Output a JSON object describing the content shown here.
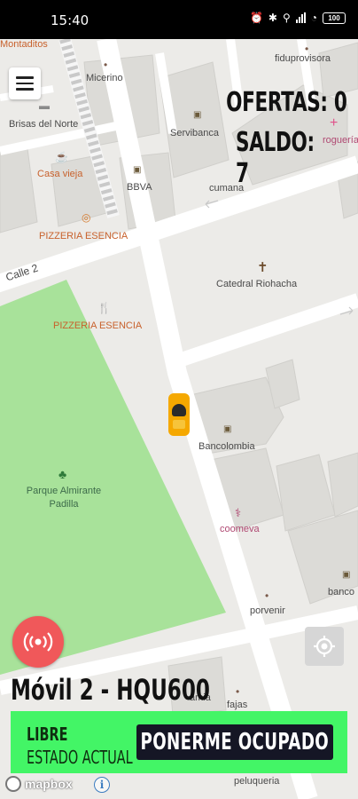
{
  "status_bar": {
    "time": "15:40",
    "battery": "100",
    "icons": [
      "alarm-icon",
      "bluetooth-icon",
      "location-icon",
      "signal-icon",
      "wifi-icon",
      "battery-icon"
    ]
  },
  "map": {
    "pois": {
      "montaditos": "Montaditos",
      "fiduprovisora": "fiduprovisora",
      "micerino": "Micerino",
      "brisas": "Brisas del Norte",
      "servibanca": "Servibanca",
      "drogueria": "roguería la eco",
      "casa_vieja": "Casa vieja",
      "bbva": "BBVA",
      "cumana": "cumana",
      "pizzeria_1": "PIZZERIA ESENCIA",
      "calle": "Calle 2",
      "catedral": "Catedral Riohacha",
      "pizzeria_2": "PIZZERIA ESENCIA",
      "bancolombia": "Bancolombia",
      "parque": "Parque Almirante Padilla",
      "coomeva": "coomeva",
      "banco": "banco",
      "porvenir": "porvenir",
      "camia": "amia",
      "fajas": "fajas",
      "peluqueria": "peluqueria"
    },
    "colors": {
      "park": "#a8e29a",
      "road": "#ffffff",
      "block": "#dcdbd7",
      "background": "#ecebe8"
    }
  },
  "overlay": {
    "offers": "OFERTAS: 0",
    "balance": "SALDO: 7",
    "vehicle": "Móvil 2 - HQU600"
  },
  "status_panel": {
    "state": "LIBRE",
    "caption": "ESTADO ACTUAL",
    "action_button": "PONERME OCUPADO",
    "color": "#43f566"
  },
  "attribution": {
    "logo": "mapbox"
  }
}
